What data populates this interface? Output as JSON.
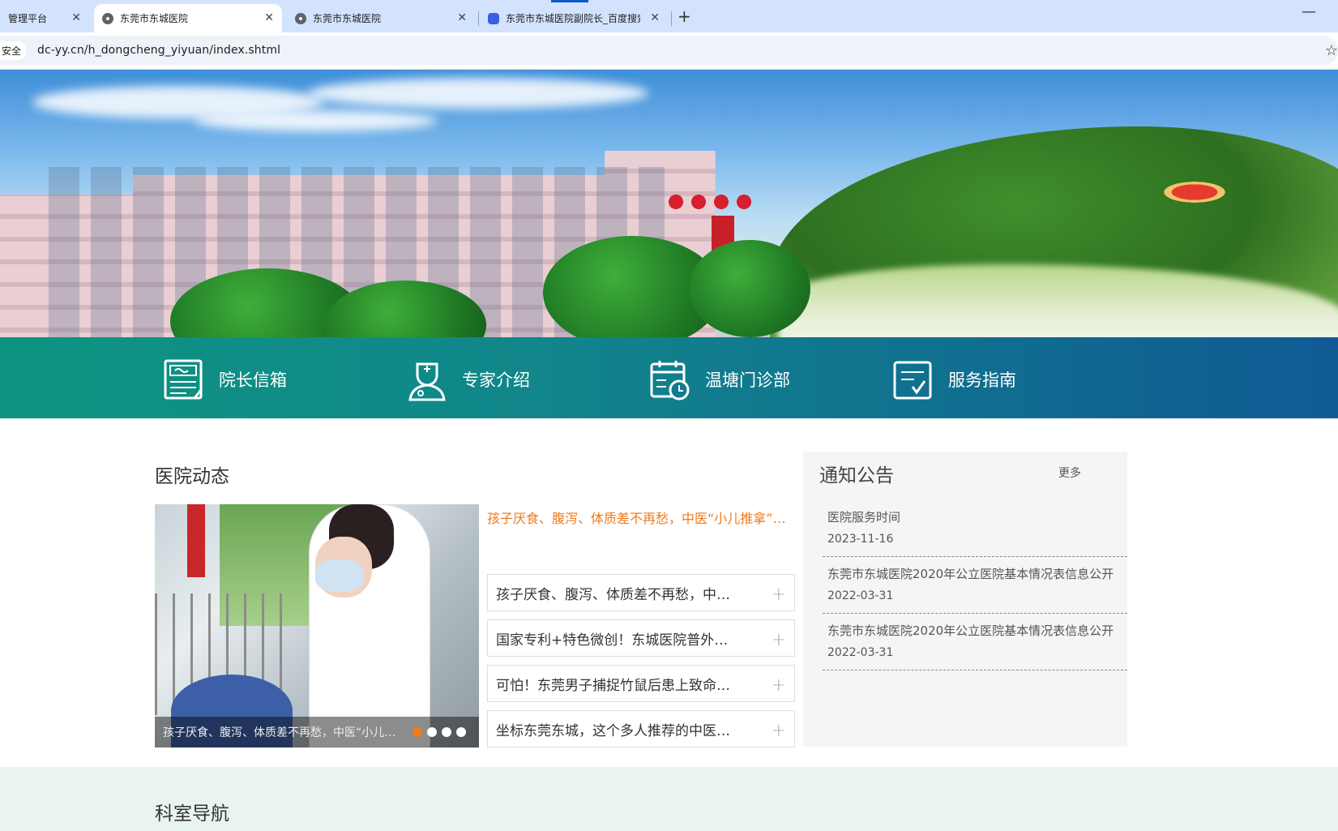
{
  "browser": {
    "tabs": [
      {
        "title": "管理平台",
        "favicon": "none"
      },
      {
        "title": "东莞市东城医院",
        "favicon": "globe-icon"
      },
      {
        "title": "东莞市东城医院",
        "favicon": "globe-icon"
      },
      {
        "title": "东莞市东城医院副院长_百度搜索",
        "favicon": "baidu-icon"
      }
    ],
    "active_tab": 1,
    "new_tab_label": "+",
    "minimize_label": "—",
    "secure_label": "安全",
    "url": "dc-yy.cn/h_dongcheng_yiyuan/index.shtml",
    "star_label": "☆"
  },
  "quick_nav": [
    {
      "label": "院长信箱",
      "icon": "mailbox-document-icon"
    },
    {
      "label": "专家介绍",
      "icon": "doctor-icon"
    },
    {
      "label": "温塘门诊部",
      "icon": "calendar-clock-icon"
    },
    {
      "label": "服务指南",
      "icon": "checklist-icon"
    }
  ],
  "news": {
    "title": "医院动态",
    "headline": "孩子厌食、腹泻、体质差不再愁，中医“小儿推拿”来帮忙",
    "photo_caption": "孩子厌食、腹泻、体质差不再愁，中医“小儿推拿”来帮忙",
    "photo_slides": 4,
    "photo_active_slide": 0,
    "items": [
      "孩子厌食、腹泻、体质差不再愁，中医“小儿推拿”来帮忙",
      "国家专利+特色微创！东城医院普外科新技术",
      "可怕！东莞男子捕捉竹鼠后患上致命疾病",
      "坐标东莞东城，这个多人推荐的中医科室"
    ],
    "item_action": "+"
  },
  "notice": {
    "title": "通知公告",
    "more_label": "更多",
    "items": [
      {
        "title": "医院服务时间",
        "date": "2023-11-16"
      },
      {
        "title": "东莞市东城医院2020年公立医院基本情况表信息公开",
        "date": "2022-03-31"
      },
      {
        "title": "东莞市东城医院2020年公立医院基本情况表信息公开",
        "date": "2022-03-31"
      }
    ]
  },
  "departments": {
    "title": "科室导航"
  },
  "colors": {
    "accent_orange": "#f07a1a",
    "nav_teal": "#0d9480",
    "nav_blue": "#105a94",
    "chrome_blue": "#d3e3fd"
  }
}
